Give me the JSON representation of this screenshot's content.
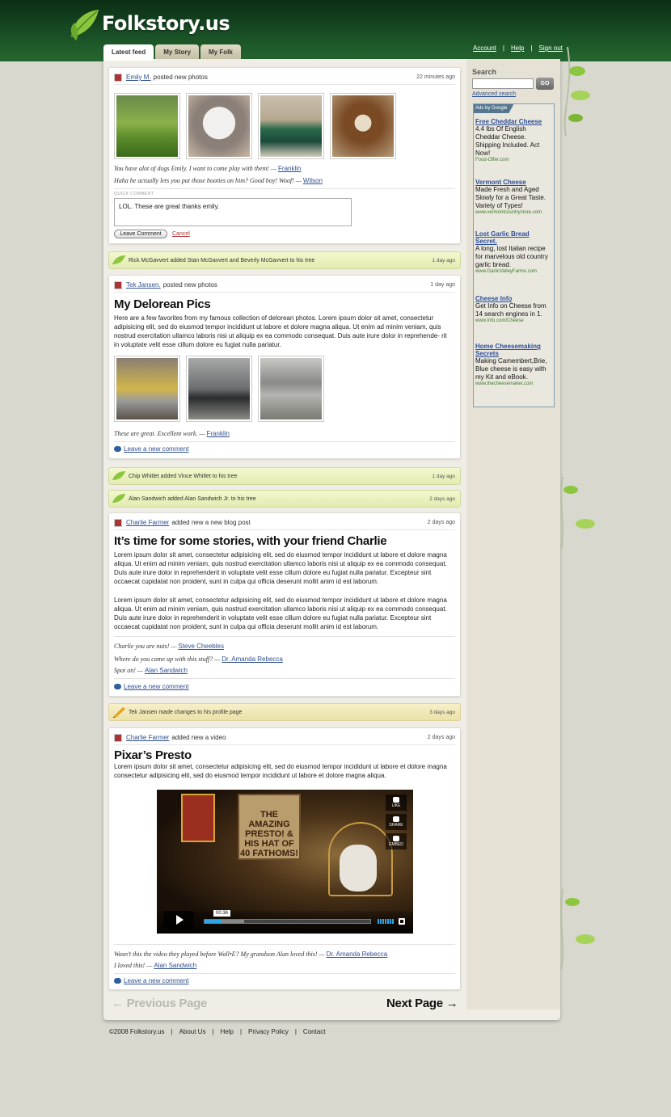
{
  "brand": {
    "name": "Folkstory.us"
  },
  "toplinks": [
    "Account",
    "Help",
    "Sign out"
  ],
  "tabs": [
    "Latest feed",
    "My Story",
    "My Folk"
  ],
  "sidebar": {
    "search_label": "Search",
    "search_placeholder": "",
    "go_label": "GO",
    "advanced_link": "Advanced search",
    "ads_by": "Ads by Google",
    "ads": [
      {
        "title": "Free Cheddar Cheese",
        "desc": "4.4 lbs Of English Cheddar Cheese. Shipping Included. Act Now!",
        "url": "Food-Offer.com"
      },
      {
        "title": "Vermont Cheese",
        "desc": "Made Fresh and Aged Slowly for a Great Taste. Variety of Types!",
        "url": "www.vermontcountrystore.com"
      },
      {
        "title": "Lost Garlic Bread Secret.",
        "desc": "A long, lost Italian recipe for marvelous old country garlic bread.",
        "url": "www.GarlicValleyFarms.com"
      },
      {
        "title": "Cheese Info",
        "desc": "Get Info on Cheese from 14 search engines in 1.",
        "url": "www.Info.com/Cheese"
      },
      {
        "title": "Home Cheesemaking Secrets",
        "desc": "Making Camembert,Brie, Blue cheese is easy with my Kit and eBook.",
        "url": "www.thecheesemaker.com"
      }
    ]
  },
  "feed": {
    "post1": {
      "author": "Emily M.",
      "action": "posted new photos",
      "time": "22 minutes ago",
      "photo_names": [
        "park-photo",
        "husky-puppy-photo",
        "dog-in-sweater-photo",
        "beagle-puppy-photo"
      ],
      "comments": [
        {
          "text": "You have alot of dogs Emily. I want to come play with them! —",
          "author": "Franklin"
        },
        {
          "text": "Haha he actually lets you put those booties on him? Good boy! Woof! —",
          "author": "Wilson"
        }
      ],
      "quick_comment_label": "QUICK COMMENT",
      "quick_comment_value": "LOL. These are great thanks emily.",
      "leave_comment": "Leave Comment",
      "cancel": "Cancel"
    },
    "act1": {
      "text": "Rick McGavvert added Stan McGavvert and Beverly McGavvert to his tree",
      "time": "1 day ago"
    },
    "post2": {
      "author": "Tek Jansen.",
      "action": "posted new photos",
      "time": "1 day ago",
      "title": "My Delorean Pics",
      "body": "Here are a few favorites from my famous collection of delorean photos. Lorem ipsum dolor sit amet, consectetur adipisicing elit, sed do eiusmod tempor incididunt ut labore et dolore magna aliqua. Ut enim ad minim veniam, quis nostrud exercitation ullamco laboris nisi ut aliquip ex ea commodo consequat. Duis aute irure dolor in reprehende- rit in voluptate velit esse cillum dolore eu fugiat nulla pariatur.",
      "comments": [
        {
          "text": "These are great. Excellent work. —",
          "author": "Franklin"
        }
      ],
      "leave_new": "Leave a new comment"
    },
    "act2": {
      "text": "Chip Whitlet added Vince Whitlet to his tree",
      "time": "1 day ago"
    },
    "act3": {
      "text": "Alan Sandwich added Alan Sandwich Jr. to his tree",
      "time": "2 days ago"
    },
    "post3": {
      "author": "Charlie Farmer",
      "action": "added new a new blog post",
      "time": "2 days ago",
      "title": "It’s time for some stories, with your friend Charlie",
      "para1": "Lorem ipsum dolor sit amet, consectetur adipisicing elit, sed do eiusmod tempor incididunt ut labore et dolore magna aliqua. Ut enim ad minim veniam, quis nostrud exercitation ullamco laboris nisi ut aliquip ex ea commodo consequat. Duis aute irure dolor in reprehenderit in voluptate velit esse cillum dolore eu fugiat nulla pariatur. Excepteur sint occaecat cupidatat non proident, sunt in culpa qui officia deserunt mollit anim id est laborum.",
      "para2": "Lorem ipsum dolor sit amet, consectetur adipisicing elit, sed do eiusmod tempor incididunt ut labore et dolore magna aliqua. Ut enim ad minim veniam, quis nostrud exercitation ullamco laboris nisi ut aliquip ex ea commodo consequat. Duis aute irure dolor in reprehenderit in voluptate velit esse cillum dolore eu fugiat nulla pariatur. Excepteur sint occaecat cupidatat non proident, sunt in culpa qui officia deserunt mollit anim id est laborum.",
      "comments": [
        {
          "text": "Charlie you are nuts! —",
          "author": "Steve Cheebles"
        },
        {
          "text": "Where do you come up with this stuff? —",
          "author": "Dr. Amanda Rebecca"
        },
        {
          "text": "Spot on! —",
          "author": "Alan Sandwich"
        }
      ],
      "leave_new": "Leave a new comment"
    },
    "act4": {
      "text": "Tek Jansen made changes to his profile page",
      "time": "3 days ago"
    },
    "post4": {
      "author": "Charlie Farmer",
      "action": "added new a video",
      "time": "2 days ago",
      "title": "Pixar’s Presto",
      "body": "Lorem ipsum dolor sit amet, consectetur adipisicing elit, sed do eiusmod tempor incididunt ut labore et dolore magna consectetur adipisicing elit, sed do eiusmod tempor incididunt ut labore et dolore magna aliqua.",
      "video": {
        "poster_text": "THE AMAZING PRESTO! & HIS HAT OF 40 FATHOMS!",
        "like": "LIKE",
        "share": "SHARE",
        "embed": "EMBED",
        "time": "00:36",
        "progress": 0.1,
        "buffered": 0.24
      },
      "comments": [
        {
          "text": "Wasn’t this the video they played before Wall•E? My grandson Alan loved this! —",
          "author": "Dr. Amanda Rebecca"
        },
        {
          "text": "I loved this! —",
          "author": "Alan Sandwich"
        }
      ],
      "leave_new": "Leave a new comment"
    }
  },
  "pager": {
    "prev": "← Previous Page",
    "next": "Next Page →"
  },
  "footer": [
    "©2008 Folkstory.us",
    "|",
    "About Us",
    "|",
    "Help",
    "|",
    "Privacy Policy",
    "|",
    "Contact"
  ]
}
